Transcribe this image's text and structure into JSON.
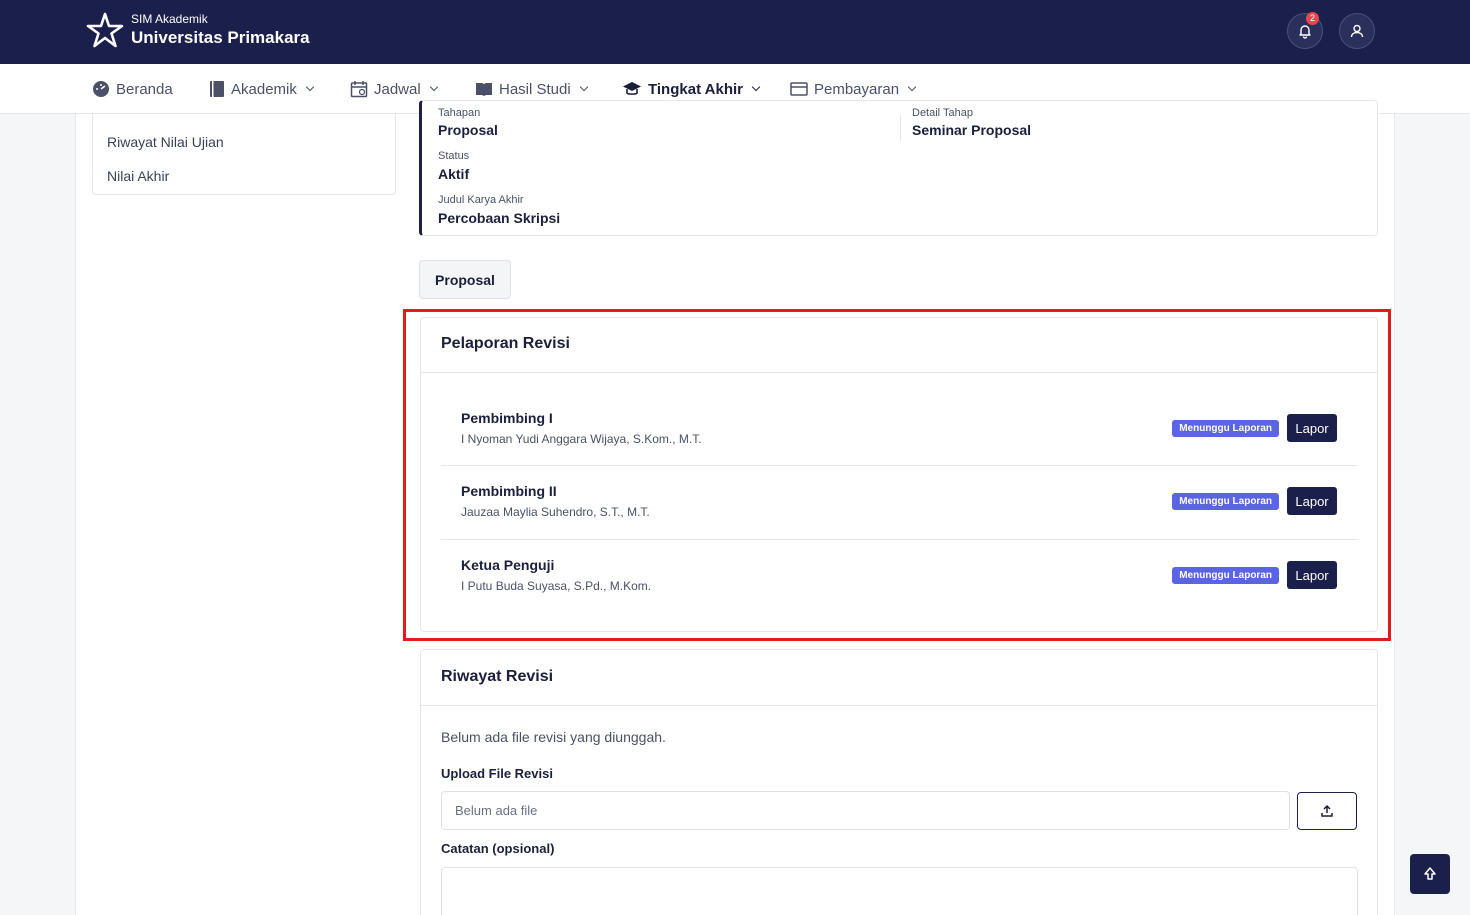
{
  "header": {
    "brand_sub": "SIM Akademik",
    "brand_main": "Universitas Primakara",
    "notification_count": "2",
    "bg_color": "#1b1f4b"
  },
  "nav": {
    "items": [
      {
        "label": "Beranda",
        "icon": "dashboard-icon"
      },
      {
        "label": "Akademik",
        "icon": "book-icon"
      },
      {
        "label": "Jadwal",
        "icon": "calendar-icon"
      },
      {
        "label": "Hasil Studi",
        "icon": "open-book-icon"
      },
      {
        "label": "Tingkat Akhir",
        "icon": "graduation-cap-icon",
        "active": true
      },
      {
        "label": "Pembayaran",
        "icon": "wallet-icon"
      }
    ]
  },
  "sidebar": {
    "links": [
      "Riwayat Nilai Ujian",
      "Nilai Akhir"
    ]
  },
  "info": {
    "tahapan_label": "Tahapan",
    "tahapan_value": "Proposal",
    "status_label": "Status",
    "status_value": "Aktif",
    "judul_label": "Judul Karya Akhir",
    "judul_value": "Percobaan Skripsi",
    "detail_label": "Detail Tahap",
    "detail_value": "Seminar Proposal"
  },
  "tab": {
    "label": "Proposal"
  },
  "pelaporan": {
    "title": "Pelaporan Revisi",
    "rows": [
      {
        "role": "Pembimbing I",
        "name": "I Nyoman Yudi Anggara Wijaya, S.Kom., M.T.",
        "status": "Menunggu Laporan",
        "action": "Lapor"
      },
      {
        "role": "Pembimbing II",
        "name": "Jauzaa Maylia Suhendro, S.T., M.T.",
        "status": "Menunggu Laporan",
        "action": "Lapor"
      },
      {
        "role": "Ketua Penguji",
        "name": "I Putu Buda Suyasa, S.Pd., M.Kom.",
        "status": "Menunggu Laporan",
        "action": "Lapor"
      }
    ],
    "badge_color": "#5b63e6"
  },
  "riwayat": {
    "title": "Riwayat Revisi",
    "empty_text": "Belum ada file revisi yang diunggah.",
    "upload_label": "Upload File Revisi",
    "file_placeholder": "Belum ada file",
    "catatan_label": "Catatan (opsional)"
  }
}
